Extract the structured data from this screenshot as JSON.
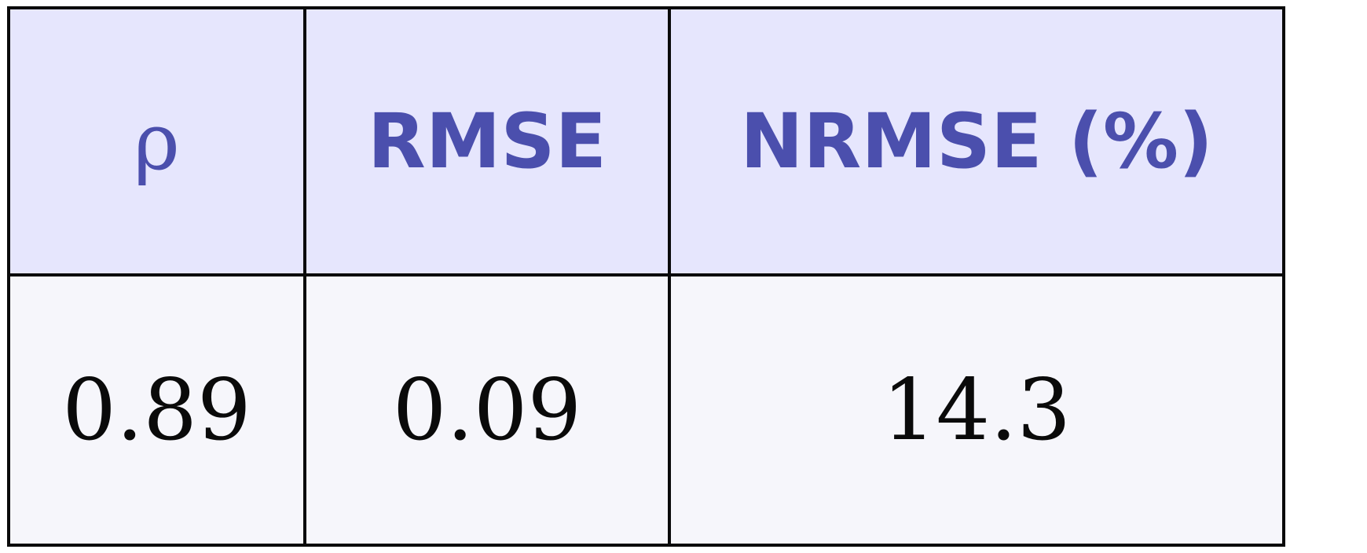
{
  "table": {
    "headers": [
      "ρ",
      "RMSE",
      "NRMSE (%)"
    ],
    "rows": [
      [
        "0.89",
        "0.09",
        "14.3"
      ]
    ]
  },
  "colors": {
    "header_background": "#e6e6fd",
    "header_text": "#4b4fad",
    "body_background": "#f6f6fb",
    "body_text": "#0a0a0a",
    "border": "#0a0a0a"
  }
}
